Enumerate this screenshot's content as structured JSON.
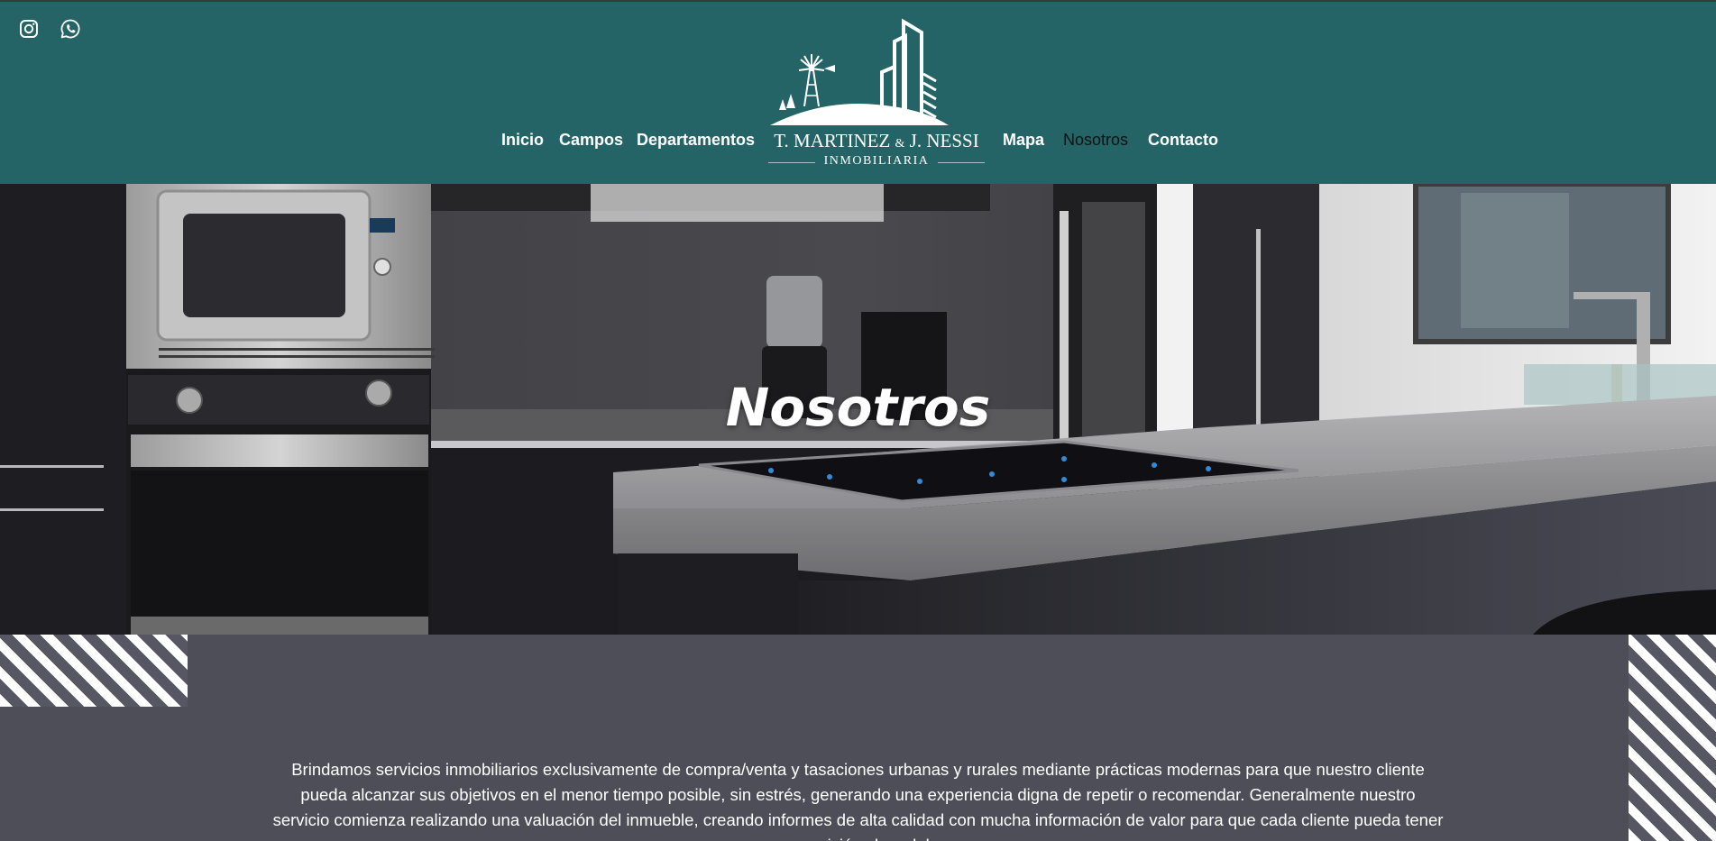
{
  "social": {
    "instagram_icon": "instagram-icon",
    "whatsapp_icon": "whatsapp-icon"
  },
  "nav": {
    "items": [
      {
        "label": "Inicio"
      },
      {
        "label": "Campos"
      },
      {
        "label": "Departamentos"
      },
      {
        "label": "Mapa"
      },
      {
        "label": "Nosotros",
        "active": true
      },
      {
        "label": "Contacto"
      }
    ]
  },
  "logo": {
    "brand_a": "T. MARTINEZ",
    "brand_amp": "&",
    "brand_b": "J. NESSI",
    "subtitle": "INMOBILIARIA"
  },
  "hero": {
    "title": "Nosotros"
  },
  "about": {
    "text": "Brindamos servicios inmobiliarios exclusivamente de compra/venta y tasaciones urbanas y rurales mediante prácticas modernas para que nuestro cliente pueda alcanzar sus objetivos en el menor tiempo posible, sin estrés, generando una experiencia digna de repetir o recomendar. Generalmente nuestro servicio comienza realizando una valuación del inmueble, creando informes de alta calidad con mucha información de valor para que cada cliente pueda tener una visión clara del"
  },
  "colors": {
    "header_bg": "#246467",
    "body_bg": "#4e4e58",
    "nav_active": "#111111"
  }
}
